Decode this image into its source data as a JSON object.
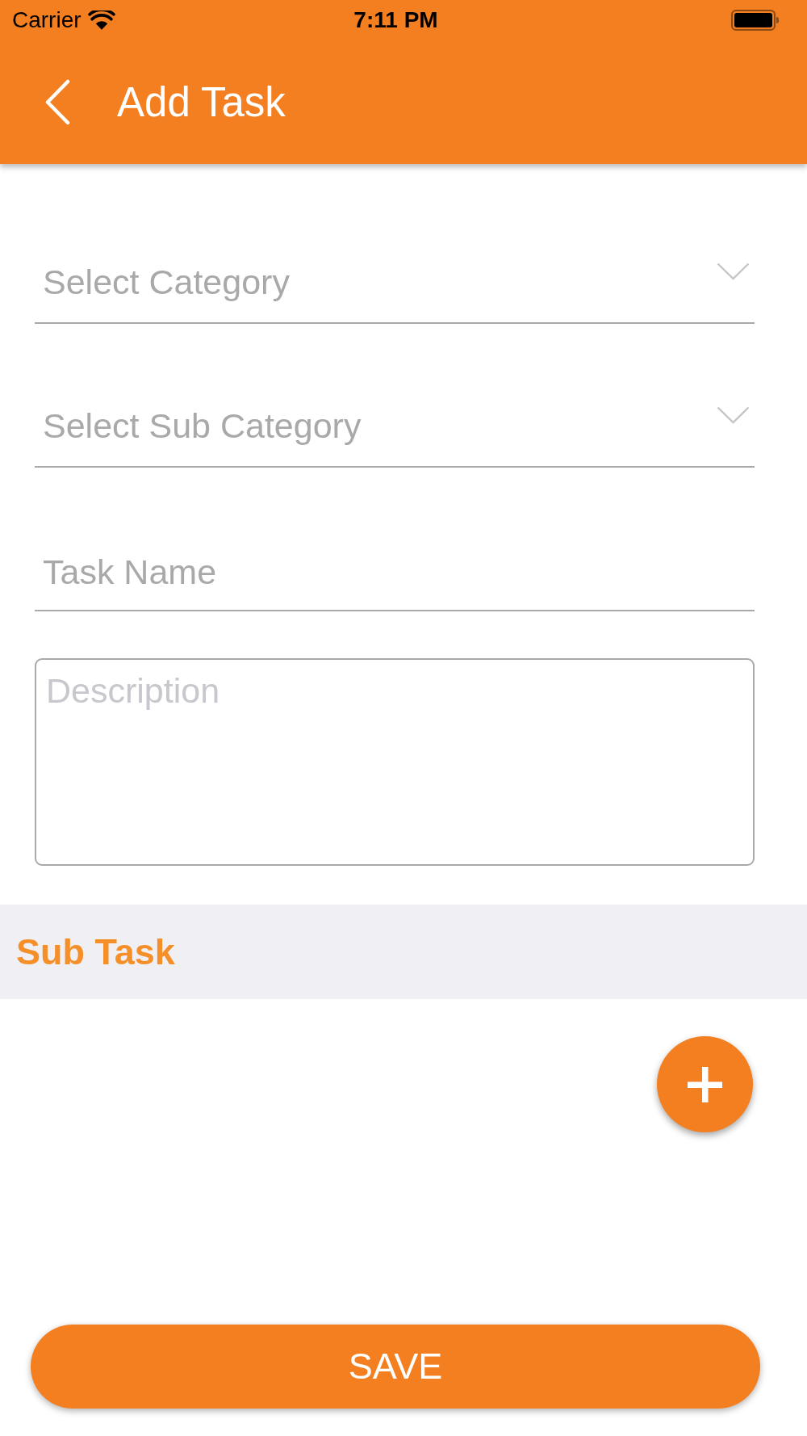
{
  "status_bar": {
    "carrier": "Carrier",
    "time": "7:11 PM"
  },
  "nav_bar": {
    "title": "Add Task"
  },
  "form": {
    "fields": [
      {
        "kind": "dropdown",
        "placeholder": "Select Category"
      },
      {
        "kind": "dropdown",
        "placeholder": "Select Sub Category"
      },
      {
        "kind": "text",
        "placeholder": "Task Name"
      },
      {
        "kind": "textarea",
        "placeholder": "Description"
      }
    ]
  },
  "sub_task_section": {
    "title": "Sub Task"
  },
  "save_button": {
    "label": "SAVE"
  }
}
